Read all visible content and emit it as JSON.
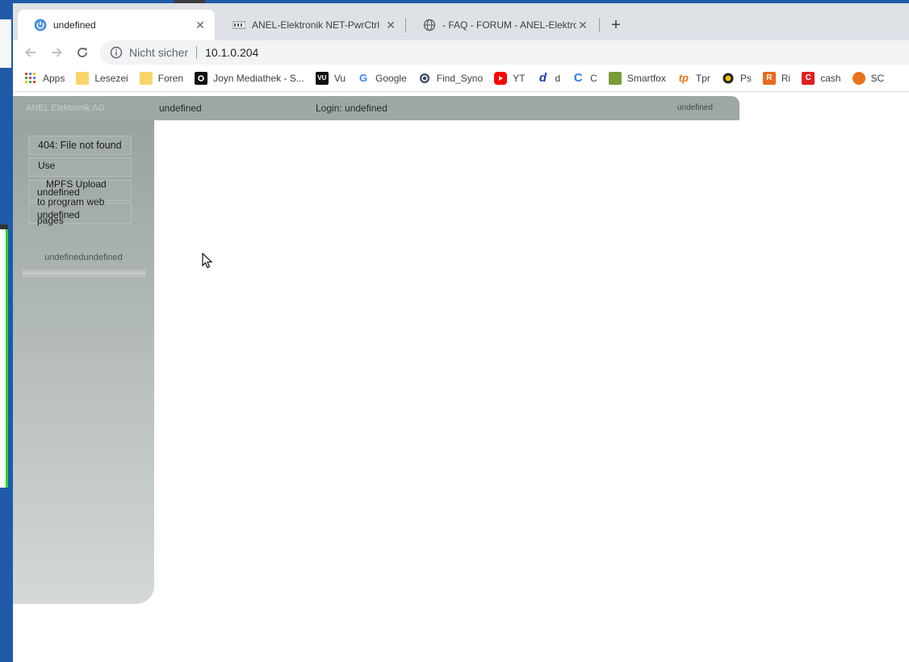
{
  "browser": {
    "tabs": [
      {
        "title": "undefined",
        "icon": "power-icon",
        "active": true
      },
      {
        "title": "ANEL-Elektronik NET-PwrCtrl",
        "icon": "anel-favicon-icon",
        "active": false
      },
      {
        "title": "- FAQ - FORUM - ANEL-Elektronik",
        "icon": "globe-icon",
        "active": false
      }
    ],
    "new_tab_label": "+",
    "address": {
      "security_label": "Nicht sicher",
      "url": "10.1.0.204"
    },
    "bookmarks": [
      {
        "label": "Apps",
        "icon": "apps-grid-icon"
      },
      {
        "label": "Lesezei",
        "icon": "folder-icon"
      },
      {
        "label": "Foren",
        "icon": "folder-icon"
      },
      {
        "label": "Joyn Mediathek - S...",
        "icon": "joyn-icon"
      },
      {
        "label": "Vu",
        "icon": "vu-icon"
      },
      {
        "label": "Google",
        "icon": "google-icon"
      },
      {
        "label": "Find_Syno",
        "icon": "synology-icon"
      },
      {
        "label": "YT",
        "icon": "youtube-icon"
      },
      {
        "label": "d",
        "icon": "d-icon"
      },
      {
        "label": "C",
        "icon": "c-icon"
      },
      {
        "label": "Smartfox",
        "icon": "smartfox-icon"
      },
      {
        "label": "Tpr",
        "icon": "tp-icon"
      },
      {
        "label": "Ps",
        "icon": "ps-icon"
      },
      {
        "label": "Ri",
        "icon": "r-icon"
      },
      {
        "label": "cash",
        "icon": "cash-icon"
      },
      {
        "label": "SC",
        "icon": "sc-icon"
      }
    ]
  },
  "app": {
    "company": "ANEL Elektronik AG",
    "header_title": "undefined",
    "login_label": "Login: undefined",
    "header_right": "undefined",
    "sidebar": {
      "item_404": "404: File not found",
      "item_use": "Use",
      "mpfs_line1": "MPFS Upload",
      "mpfs_line2": "to program web",
      "mpfs_line3": "pages",
      "undefined_1": "undefined",
      "undefined_2": "undefined",
      "footer": "undefinedundefined"
    }
  },
  "colors": {
    "header_bg": "#9ea8a3",
    "sidebar_top": "#98a39e",
    "sidebar_bottom": "#d4d8d7",
    "tabstrip_bg": "#dee1e6"
  }
}
